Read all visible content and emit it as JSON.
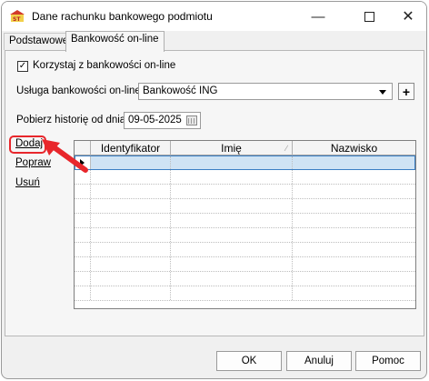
{
  "window": {
    "title": "Dane rachunku bankowego podmiotu"
  },
  "tabs": [
    {
      "label": "Podstawowe",
      "active": false
    },
    {
      "label": "Bankowość on-line",
      "active": true
    }
  ],
  "form": {
    "use_online_checkbox_label": "Korzystaj z bankowości on-line",
    "use_online_checked": true,
    "service_label": "Usługa bankowości on-line:",
    "service_value": "Bankowość ING",
    "add_service_label": "+",
    "history_label": "Pobierz historię od dnia:",
    "history_date": "09-05-2025"
  },
  "actions": {
    "add": "Dodaj",
    "edit": "Popraw",
    "delete": "Usuń"
  },
  "grid": {
    "columns": [
      "Identyfikator",
      "Imię",
      "Nazwisko"
    ],
    "rows": []
  },
  "footer": {
    "ok": "OK",
    "cancel": "Anuluj",
    "help": "Pomoc"
  },
  "colors": {
    "highlight": "#e8262b",
    "selected_row": "#cfe3f4"
  }
}
